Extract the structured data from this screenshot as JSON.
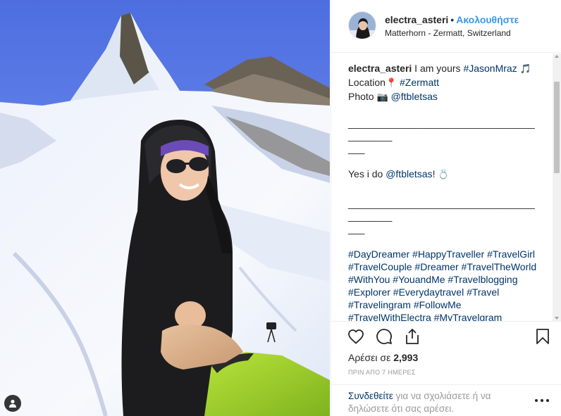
{
  "post": {
    "username": "electra_asteri",
    "separator": "•",
    "follow_label": "Ακολουθήστε",
    "location": "Matterhorn - Zermatt, Switzerland"
  },
  "caption": {
    "username": "electra_asteri",
    "line1_text": " I am yours ",
    "line1_tag": "#JasonMraz",
    "line1_emoji": "🎵",
    "line2_text": "Location",
    "line2_emoji": "📍",
    "line2_tag": "#Zermatt",
    "line3_text": "Photo ",
    "line3_emoji": "📷",
    "line3_mention": "@ftbletsas",
    "divider1": "__________________________________________",
    "divider1_tail": "___",
    "line4_text": "Yes i do ",
    "line4_mention": "@ftbletsas",
    "line4_suffix": "!",
    "line4_emoji": "💍",
    "divider2": "__________________________________________",
    "divider2_tail": "___",
    "hashtags": "#DayDreamer #HappyTraveller #TravelGirl #TravelCouple  #Dreamer #TravelTheWorld #WithYou #YouandMe #Travelblogging #Explorer #Everydaytravel  #Travel #Travelingram #FollowMe #TravelWithElectra #MyTravelgram #Travellers #CoupleTravel #Wanderlust #proposal #InstaPassport #VisitZermatt #switzerland #matterhorn #skiwinter"
  },
  "actions": {
    "like_icon": "heart-icon",
    "comment_icon": "comment-icon",
    "share_icon": "share-icon",
    "save_icon": "bookmark-icon",
    "likes_prefix": "Αρέσει σε ",
    "likes_count": "2,993",
    "timestamp": "ΠΡΙΝ ΑΠΟ 7 ΗΜΕΡΕΣ"
  },
  "footer": {
    "login_link": "Συνδεθείτε",
    "login_text": " για να σχολιάσετε ή να δηλώσετε ότι σας αρέσει.",
    "more_icon": "more-options-icon"
  },
  "colors": {
    "link_blue": "#3897f0",
    "hashtag_navy": "#003569",
    "text": "#262626",
    "muted": "#999999",
    "border": "#efefef"
  }
}
